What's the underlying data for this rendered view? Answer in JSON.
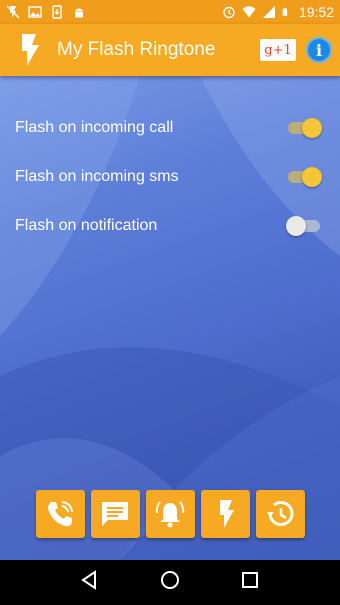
{
  "status_bar": {
    "time": "19:52",
    "left_icons": [
      "flash-off-icon",
      "image-icon",
      "download-icon",
      "android-icon"
    ],
    "right_icons": [
      "alarm-icon",
      "wifi-icon",
      "signal-icon",
      "battery-icon"
    ]
  },
  "app_bar": {
    "title": "My Flash Ringtone",
    "gplus_label": "g+1",
    "info_label": "i",
    "color": "#f6a922"
  },
  "settings": [
    {
      "label": "Flash on incoming call",
      "enabled": true
    },
    {
      "label": "Flash on incoming sms",
      "enabled": true
    },
    {
      "label": "Flash on notification",
      "enabled": false
    }
  ],
  "bottom_tabs": [
    {
      "icon": "phone-call-icon"
    },
    {
      "icon": "sms-icon"
    },
    {
      "icon": "notification-bell-icon"
    },
    {
      "icon": "flash-icon"
    },
    {
      "icon": "history-icon"
    }
  ],
  "nav_bar": {
    "buttons": [
      "back-icon",
      "home-icon",
      "recents-icon"
    ]
  }
}
